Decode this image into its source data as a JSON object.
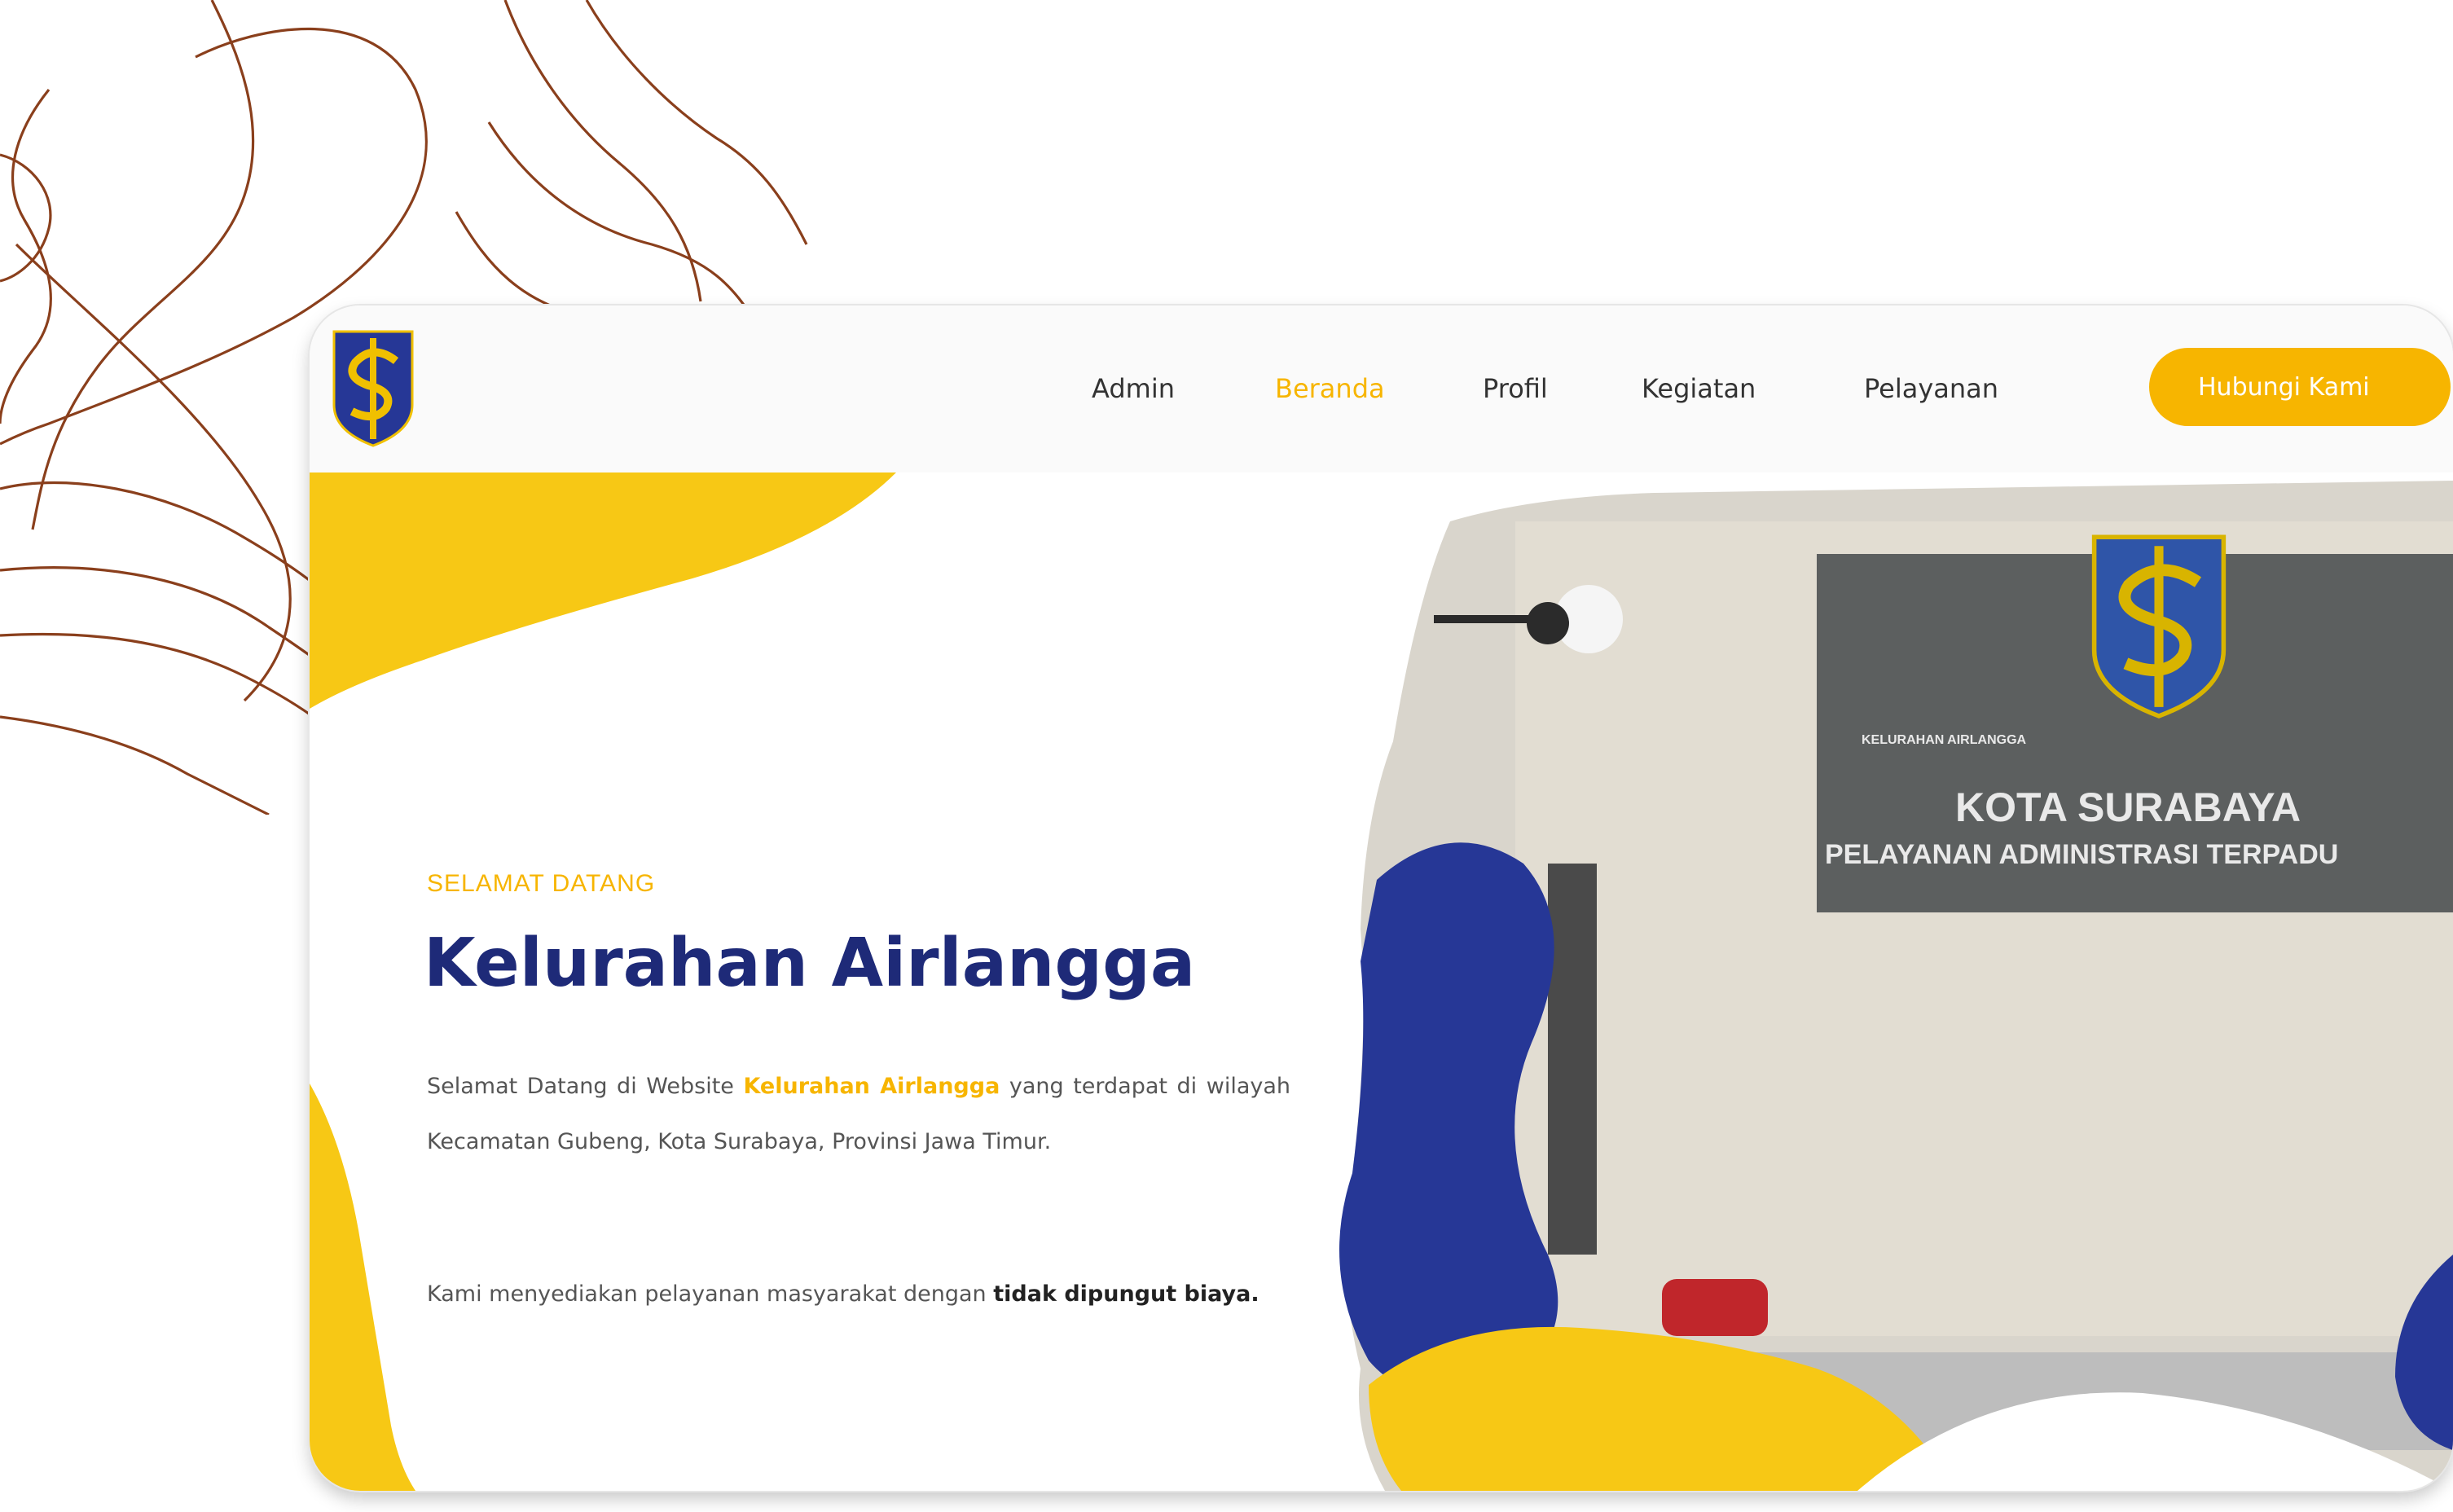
{
  "nav": {
    "items": [
      {
        "label": "Admin",
        "active": false
      },
      {
        "label": "Beranda",
        "active": true
      },
      {
        "label": "Profil",
        "active": false
      },
      {
        "label": "Kegiatan",
        "active": false
      },
      {
        "label": "Pelayanan",
        "active": false
      }
    ],
    "cta_label": "Hubungi Kami"
  },
  "hero": {
    "welcome": "SELAMAT DATANG",
    "title": "Kelurahan Airlangga",
    "para1_prefix": "Selamat Datang di Website ",
    "para1_highlight": "Kelurahan Airlangga",
    "para1_suffix": " yang terdapat di wilayah Kecamatan Gubeng, Kota Surabaya, Provinsi Jawa Timur.",
    "para2_prefix": "Kami menyediakan pelayanan masyarakat dengan ",
    "para2_bold": "tidak dipungut biaya."
  },
  "sign": {
    "line1": "KELURAHAN AIRLANGGA",
    "line2": "KOTA SURABAYA",
    "line3": "PELAYANAN ADMINISTRASI TERPADU"
  },
  "colors": {
    "accent": "#f7b500",
    "navy": "#1e2a78",
    "blob_blue": "#263796",
    "contour": "#8a3f1c"
  }
}
